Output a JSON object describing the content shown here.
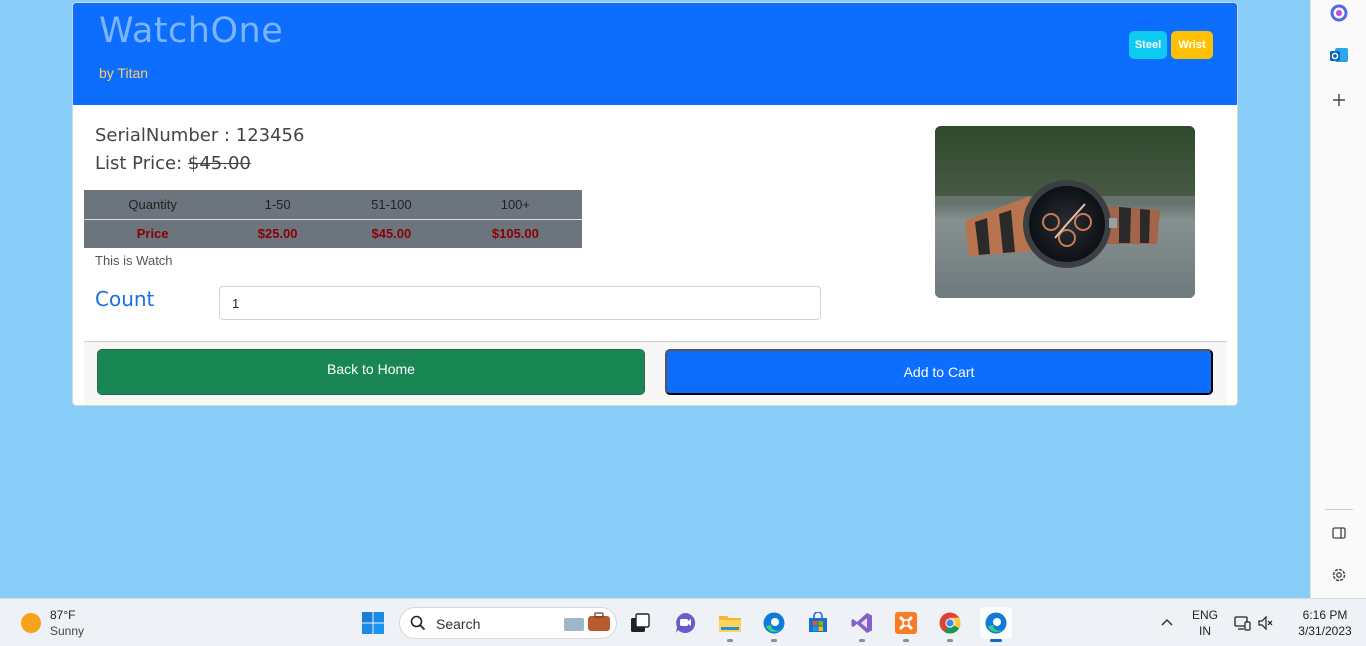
{
  "header": {
    "brand": "WatchOne",
    "subtitle": "by Titan",
    "badges": [
      "Steel",
      "Wrist"
    ]
  },
  "product": {
    "serial_text": "SerialNumber : 123456",
    "list_price_label": "List Price:",
    "list_price_value": "$45.00",
    "description": "This is Watch",
    "image_icon": "watch-photo"
  },
  "pricing": {
    "headers": [
      "Quantity",
      "1-50",
      "51-100",
      "100+"
    ],
    "prices": [
      "Price",
      "$25.00",
      "$45.00",
      "$105.00"
    ]
  },
  "count": {
    "label": "Count",
    "value": "1"
  },
  "buttons": {
    "back_home": "Back to Home",
    "add_cart": "Add to Cart"
  },
  "colors": {
    "page_bg": "#87cdf7",
    "header_bg": "#0d6efd",
    "home_btn": "#198754",
    "cart_btn": "#0d6efd",
    "badge_steel": "#0dcaf0",
    "badge_wrist": "#ffc107",
    "price_text": "#8b0000"
  },
  "sidebar": {
    "icons": [
      "copilot-icon",
      "outlook-icon",
      "add-icon",
      "sidebar-toggle-icon",
      "settings-icon"
    ]
  },
  "taskbar": {
    "weather_temp": "87°F",
    "weather_condition": "Sunny",
    "search_placeholder": "Search",
    "language": "ENG",
    "region": "IN",
    "time": "6:16 PM",
    "date": "3/31/2023",
    "apps": [
      "windows-start-icon",
      "task-view-icon",
      "teams-icon",
      "file-explorer-icon",
      "edge-icon",
      "store-icon",
      "visual-studio-icon",
      "xampp-icon",
      "chrome-icon",
      "edge-active-icon"
    ]
  }
}
